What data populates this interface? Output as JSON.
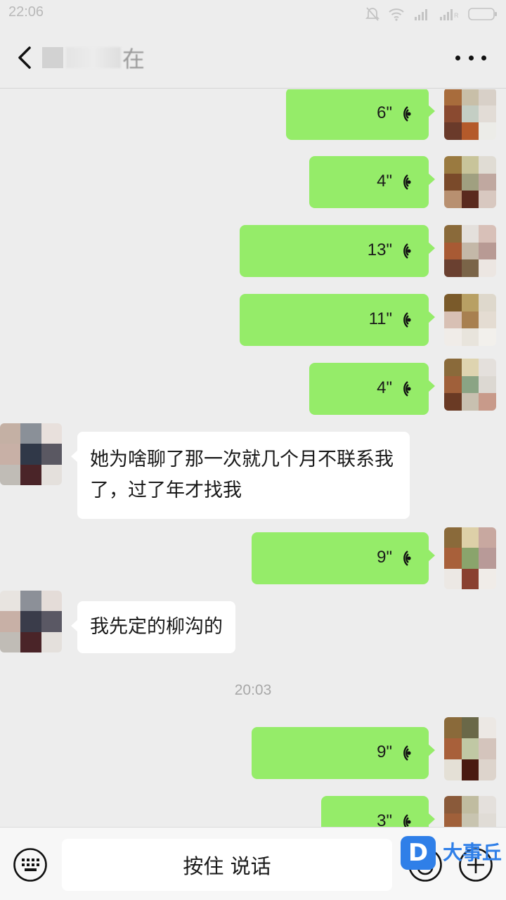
{
  "status_bar": {
    "time": "22:06",
    "icons": [
      "mute-icon",
      "wifi-icon",
      "signal-icon",
      "signal-icon",
      "battery-icon"
    ]
  },
  "header": {
    "back_icon": "chevron-left-icon",
    "title": "在",
    "more_icon": "more-dots-icon"
  },
  "messages": [
    {
      "type": "voice",
      "from": "me",
      "duration": "6\""
    },
    {
      "type": "voice",
      "from": "me",
      "duration": "4\""
    },
    {
      "type": "voice",
      "from": "me",
      "duration": "13\""
    },
    {
      "type": "voice",
      "from": "me",
      "duration": "11\""
    },
    {
      "type": "voice",
      "from": "me",
      "duration": "4\""
    },
    {
      "type": "text",
      "from": "other",
      "text": "她为啥聊了那一次就几个月不联系我了，过了年才找我"
    },
    {
      "type": "voice",
      "from": "me",
      "duration": "9\""
    },
    {
      "type": "text",
      "from": "other",
      "text": "我先定的柳沟的"
    },
    {
      "type": "timestamp",
      "text": "20:03"
    },
    {
      "type": "voice",
      "from": "me",
      "duration": "9\""
    },
    {
      "type": "voice",
      "from": "me",
      "duration": "3\""
    }
  ],
  "input_bar": {
    "keyboard_icon": "keyboard-icon",
    "hold_to_talk_label": "按住 说话",
    "emoji_icon": "emoji-icon",
    "plus_icon": "plus-icon"
  },
  "watermark": {
    "logo_letter": "D",
    "text": "大事丘"
  },
  "colors": {
    "background": "#ededed",
    "outgoing_bubble": "#95ec69",
    "incoming_bubble": "#ffffff"
  }
}
